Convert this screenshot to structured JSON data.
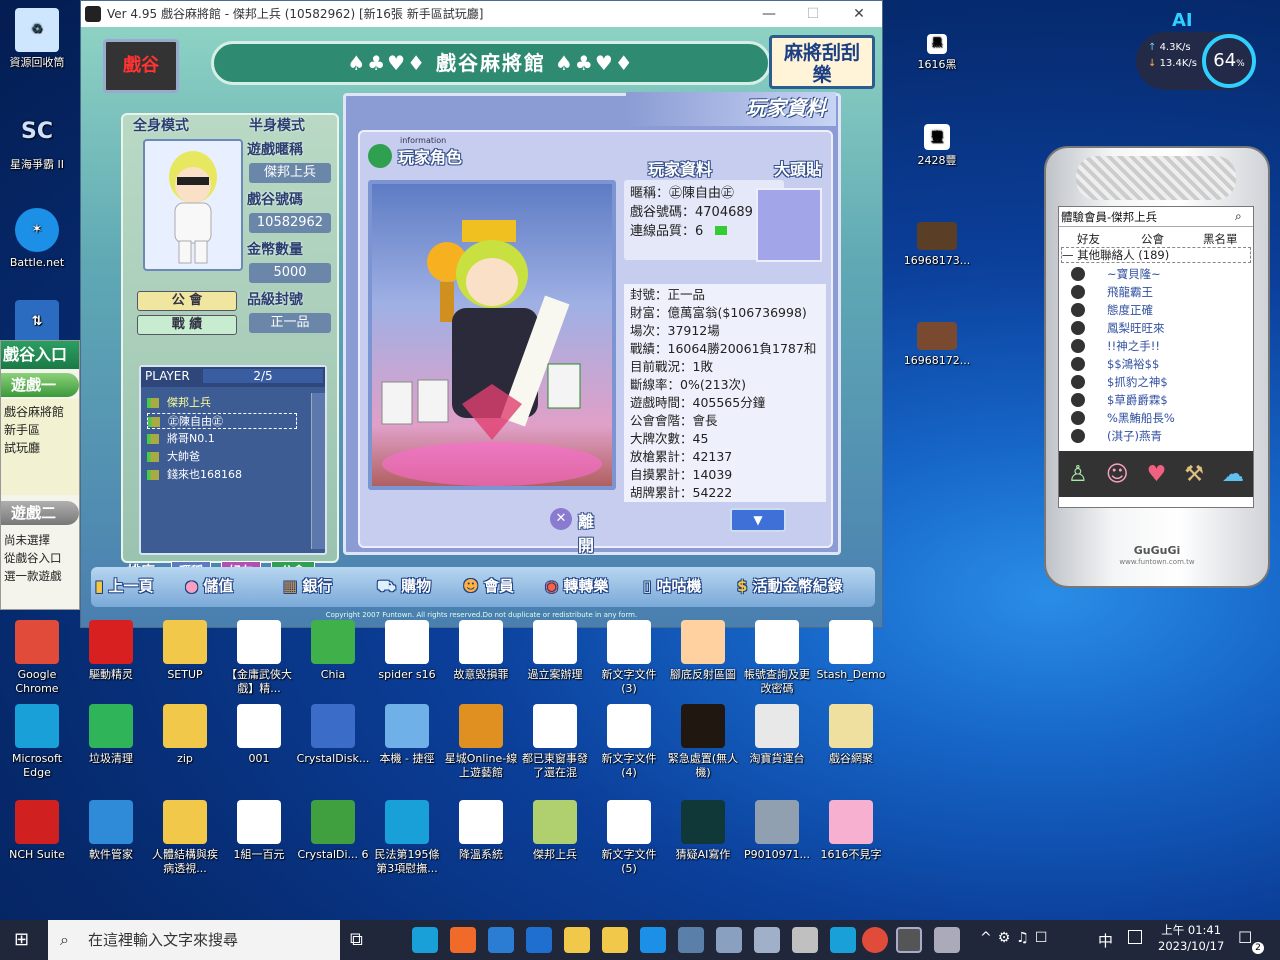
{
  "desktop": {
    "left_icons": [
      {
        "label": "資源回收筒",
        "icon": "recycle-bin-icon",
        "color": "#cfe6ff"
      },
      {
        "label": "星海爭霸 II",
        "icon": "starcraft-icon",
        "color": "#5a7fa8"
      },
      {
        "label": "Battle.net",
        "icon": "battlenet-icon",
        "color": "#1c8fe6"
      },
      {
        "label": "",
        "icon": "network-icon",
        "color": "#2b6cc0"
      }
    ],
    "right_icons": [
      {
        "label": "1616黑",
        "icon": "file-icon"
      },
      {
        "label": "2428豐",
        "icon": "file-icon"
      },
      {
        "label": "16968173...",
        "icon": "video-icon"
      },
      {
        "label": "16968172...",
        "icon": "video-icon"
      }
    ],
    "row1": [
      {
        "label": "Google Chrome",
        "color": "#e04b3a"
      },
      {
        "label": "驅動精灵",
        "color": "#d82020"
      },
      {
        "label": "SETUP",
        "color": "#f2c84a"
      },
      {
        "label": "【金庸武俠大戲】精...",
        "color": "#ffffff"
      },
      {
        "label": "Chia",
        "color": "#3fb04a"
      },
      {
        "label": "spider s16",
        "color": "#ffffff"
      },
      {
        "label": "故意毀損罪",
        "color": "#ffffff"
      },
      {
        "label": "過立案辦理",
        "color": "#ffffff"
      },
      {
        "label": "新文字文件 (3)",
        "color": "#ffffff"
      },
      {
        "label": "腳底反射區圖",
        "color": "#ffd0a0"
      },
      {
        "label": "帳號查詢及更改密碼",
        "color": "#ffffff"
      },
      {
        "label": "Stash_Demo",
        "color": "#ffffff"
      }
    ],
    "row2": [
      {
        "label": "Microsoft Edge",
        "color": "#1aa0d8"
      },
      {
        "label": "垃圾清理",
        "color": "#2fb45a"
      },
      {
        "label": "zip",
        "color": "#f2c84a"
      },
      {
        "label": "001",
        "color": "#ffffff"
      },
      {
        "label": "CrystalDisk...",
        "color": "#3a6cc8"
      },
      {
        "label": "本機 - 捷徑",
        "color": "#6fb0e8"
      },
      {
        "label": "星城Online-線上遊藝館",
        "color": "#e09020"
      },
      {
        "label": "都已東窗事發了還在混",
        "color": "#ffffff"
      },
      {
        "label": "新文字文件 (4)",
        "color": "#ffffff"
      },
      {
        "label": "緊急處置(無人機)",
        "color": "#201810"
      },
      {
        "label": "淘寶貨運台",
        "color": "#e8e8e8"
      },
      {
        "label": "戲谷網聚",
        "color": "#f0e0a0"
      }
    ],
    "row3": [
      {
        "label": "NCH Suite",
        "color": "#d02020"
      },
      {
        "label": "軟件管家",
        "color": "#2f8ad8"
      },
      {
        "label": "人體結構與疾病透視...",
        "color": "#f2c84a"
      },
      {
        "label": "1組一百元",
        "color": "#ffffff"
      },
      {
        "label": "CrystalDi... 6",
        "color": "#40a040"
      },
      {
        "label": "民法第195條第3項慰撫...",
        "color": "#1aa0d8"
      },
      {
        "label": "降溫系統",
        "color": "#ffffff"
      },
      {
        "label": "傑邦上兵",
        "color": "#b0d070"
      },
      {
        "label": "新文字文件 (5)",
        "color": "#ffffff"
      },
      {
        "label": "猜疑AI寫作",
        "color": "#103838"
      },
      {
        "label": "P9010971...",
        "color": "#90a0b0"
      },
      {
        "label": "1616不見字",
        "color": "#f7b0d0"
      }
    ]
  },
  "side_panel": {
    "title": "戲谷入口",
    "game1": "遊戲一",
    "game1_items": [
      "戲谷麻將館",
      "新手區",
      "試玩廳"
    ],
    "game2": "遊戲二",
    "game2_items": [
      "尚未選擇",
      "從戲谷入口",
      "選一款遊戲"
    ]
  },
  "game_window": {
    "title": "Ver 4.95 戲谷麻將館 - 傑邦上兵 (10582962) [新16張 新手區試玩廳]",
    "banner": "♠♣♥♦ 戲谷麻將館 ♠♣♥♦",
    "badge_right": "麻將刮刮樂",
    "logo_left": "戲谷",
    "left": {
      "tab_full": "全身模式",
      "tab_half": "半身模式",
      "nickname_label": "遊戲暱稱",
      "nickname": "傑邦上兵",
      "id_label": "戲谷號碼",
      "id": "10582962",
      "coins_label": "金幣數量",
      "coins": "5000",
      "rank_label": "品級封號",
      "rank": "正一品",
      "guild_btn": "公 會",
      "record_btn": "戰 績",
      "player_label": "PLAYER",
      "player_count": "2/5",
      "players": [
        "傑邦上兵",
        "㊣陳自由㊣",
        "將哥N0.1",
        "大帥爸",
        "錢來也168168"
      ],
      "sort_btn": "排序",
      "nick_btn": "暱稱",
      "friend_btn": "好友",
      "guild2_btn": "公會"
    },
    "main": {
      "header": "玩家資料",
      "tab_role": "玩家角色",
      "tab_info_small": "information",
      "tab_profile": "玩家資料",
      "tab_sticker": "大頭貼",
      "info_nick": "暱稱：㊣陳自由㊣",
      "info_id": "戲谷號碼：4704689",
      "info_quality": "連線品質：6",
      "stats": [
        "封號：正一品",
        "財富：億萬富翁($106736998)",
        "場次：37912場",
        "戰績：16064勝20061負1787和",
        "目前戰況：1敗",
        "斷線率：0%(213次)",
        "遊戲時間：405565分鐘",
        "公會會階：會長",
        "大牌次數：45",
        "放槍累計：42137",
        "自摸累計：14039",
        "胡牌累計：54222"
      ],
      "leave_btn": "離開"
    },
    "bottom": [
      {
        "label": "上一頁",
        "icon": "back-icon"
      },
      {
        "label": "儲值",
        "icon": "piggy-icon"
      },
      {
        "label": "銀行",
        "icon": "bank-icon"
      },
      {
        "label": "購物",
        "icon": "cart-icon"
      },
      {
        "label": "會員",
        "icon": "member-icon"
      },
      {
        "label": "轉轉樂",
        "icon": "spin-icon"
      },
      {
        "label": "咕咕機",
        "icon": "phone-icon"
      },
      {
        "label": "活動金幣紀錄",
        "icon": "coin-icon"
      }
    ],
    "copyright": "Copyright 2007 Funtown. All rights reserved.Do not duplicate or redistribute in any form."
  },
  "phone": {
    "title": "體驗會員-傑邦上兵",
    "tab_friends": "好友",
    "tab_guild": "公會",
    "tab_blacklist": "黑名單",
    "group": "其他聯絡人 (189)",
    "contacts": [
      "~寶貝隆~",
      "飛龍霸王",
      "態度正確",
      "鳳梨旺旺來",
      "!!神之手!!",
      "$$鴻裕$$",
      "$抓豹之神$",
      "$草爵爵霖$",
      "%黑鮪船長%",
      "(淇子)燕青"
    ],
    "brand": "GuGuGi",
    "brand_url": "www.funtown.com.tw"
  },
  "network_widget": {
    "up": "4.3K/s",
    "down": "13.4K/s",
    "percent": "64",
    "unit": "%",
    "ai": "AI"
  },
  "taskbar": {
    "search_placeholder": "在這裡輸入文字來搜尋",
    "time": "上午 01:41",
    "date": "2023/10/17",
    "ime": "中",
    "notif": "2"
  }
}
